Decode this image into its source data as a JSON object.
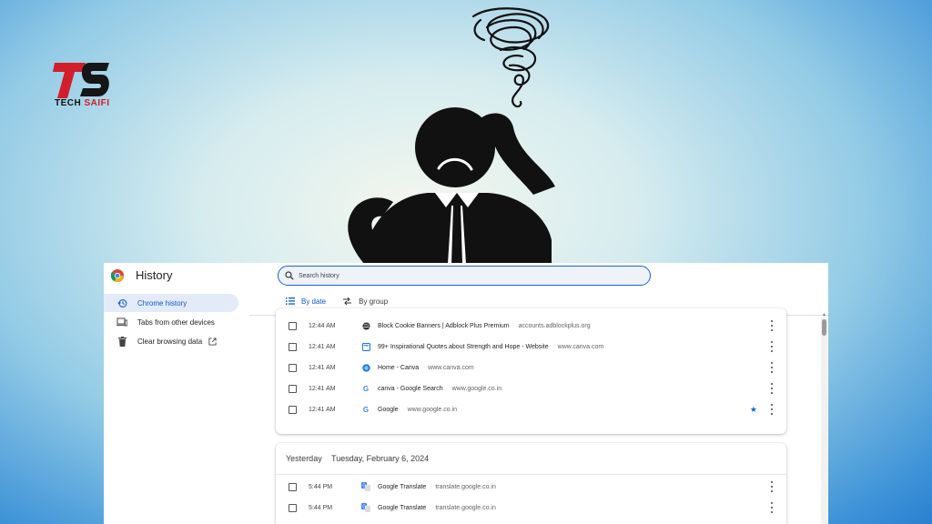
{
  "logo": {
    "text_part1": "TECH ",
    "text_part2": "SAIFI",
    "monogram": "TS",
    "colors": {
      "red": "#d21e2b",
      "dark": "#111111"
    }
  },
  "sidebar": {
    "title": "History",
    "items": [
      {
        "label": "Chrome history",
        "icon": "history-icon",
        "active": true
      },
      {
        "label": "Tabs from other devices",
        "icon": "devices-icon",
        "active": false
      },
      {
        "label": "Clear browsing data",
        "icon": "trash-icon",
        "active": false,
        "trailing_icon": "open-in-new-icon"
      }
    ]
  },
  "search": {
    "placeholder": "Search history"
  },
  "tabs": [
    {
      "label": "By date",
      "icon": "list-icon",
      "active": true
    },
    {
      "label": "By group",
      "icon": "group-icon",
      "active": false
    }
  ],
  "today_rows": [
    {
      "time": "12:44 AM",
      "title": "Block Cookie Banners | Adblock Plus Premium",
      "domain": "accounts.adblockplus.org",
      "favicon": "globe-icon",
      "starred": false
    },
    {
      "time": "12:41 AM",
      "title": "99+ Inspirational Quotes about Strength and Hope - Website",
      "domain": "www.canva.com",
      "favicon": "canva-doc-icon",
      "starred": false
    },
    {
      "time": "12:41 AM",
      "title": "Home - Canva",
      "domain": "www.canva.com",
      "favicon": "canva-icon",
      "starred": false
    },
    {
      "time": "12:41 AM",
      "title": "canva - Google Search",
      "domain": "www.google.co.in",
      "favicon": "google-icon",
      "starred": false
    },
    {
      "time": "12:41 AM",
      "title": "Google",
      "domain": "www.google.co.in",
      "favicon": "google-icon",
      "starred": true
    }
  ],
  "yesterday": {
    "label": "Yesterday",
    "date": "Tuesday, February 6, 2024",
    "rows": [
      {
        "time": "5:44 PM",
        "title": "Google Translate",
        "domain": "translate.google.co.in",
        "favicon": "translate-icon"
      },
      {
        "time": "5:44 PM",
        "title": "Google Translate",
        "domain": "translate.google.co.in",
        "favicon": "translate-icon"
      }
    ]
  },
  "colors": {
    "accent": "#0b57d0",
    "active_nav_bg": "#e3ebf8",
    "star": "#1a64d6"
  }
}
